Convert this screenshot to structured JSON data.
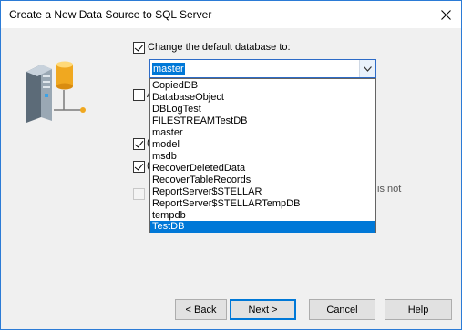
{
  "window": {
    "title": "Create a New Data Source to SQL Server"
  },
  "options": {
    "change_default_db_label": "Change the default database to:",
    "change_default_db_checked": true,
    "partial_a": "A",
    "partial_c1": "(",
    "partial_c2": "(",
    "partial_not": "is not"
  },
  "database_combo": {
    "value": "master",
    "items": [
      "CopiedDB",
      "DatabaseObject",
      "DBLogTest",
      "FILESTREAMTestDB",
      "master",
      "model",
      "msdb",
      "RecoverDeletedData",
      "RecoverTableRecords",
      "ReportServer$STELLAR",
      "ReportServer$STELLARTempDB",
      "tempdb",
      "TestDB"
    ],
    "highlighted": "TestDB"
  },
  "buttons": {
    "back": "< Back",
    "next": "Next >",
    "cancel": "Cancel",
    "help": "Help"
  },
  "icons": {
    "close": "close-icon",
    "datasource": "server-datasource-icon",
    "dropdown": "chevron-down-icon"
  },
  "colors": {
    "highlight": "#0078d7",
    "window_border": "#2b7bd6"
  }
}
